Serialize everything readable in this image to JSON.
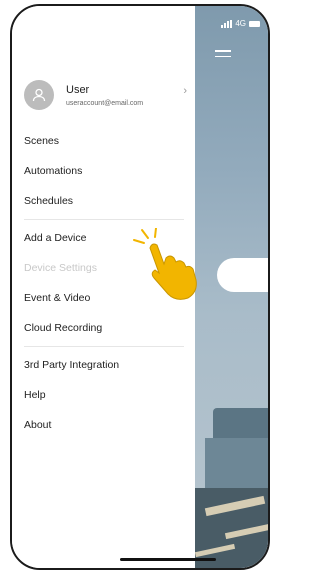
{
  "status_bar": {
    "network": "4G"
  },
  "profile": {
    "name": "User",
    "email": "useraccount@email.com"
  },
  "menu": {
    "scenes": "Scenes",
    "automations": "Automations",
    "schedules": "Schedules",
    "add_device": "Add a Device",
    "device_settings": "Device Settings",
    "event_video": "Event & Video",
    "cloud_recording": "Cloud Recording",
    "third_party": "3rd Party Integration",
    "help": "Help",
    "about": "About"
  },
  "colors": {
    "accent_hand": "#f2b500",
    "avatar": "#bcbcbc"
  },
  "icons": [
    "user-icon",
    "chevron-right-icon",
    "menu-icon",
    "signal-icon",
    "battery-icon",
    "tap-hand-icon"
  ]
}
